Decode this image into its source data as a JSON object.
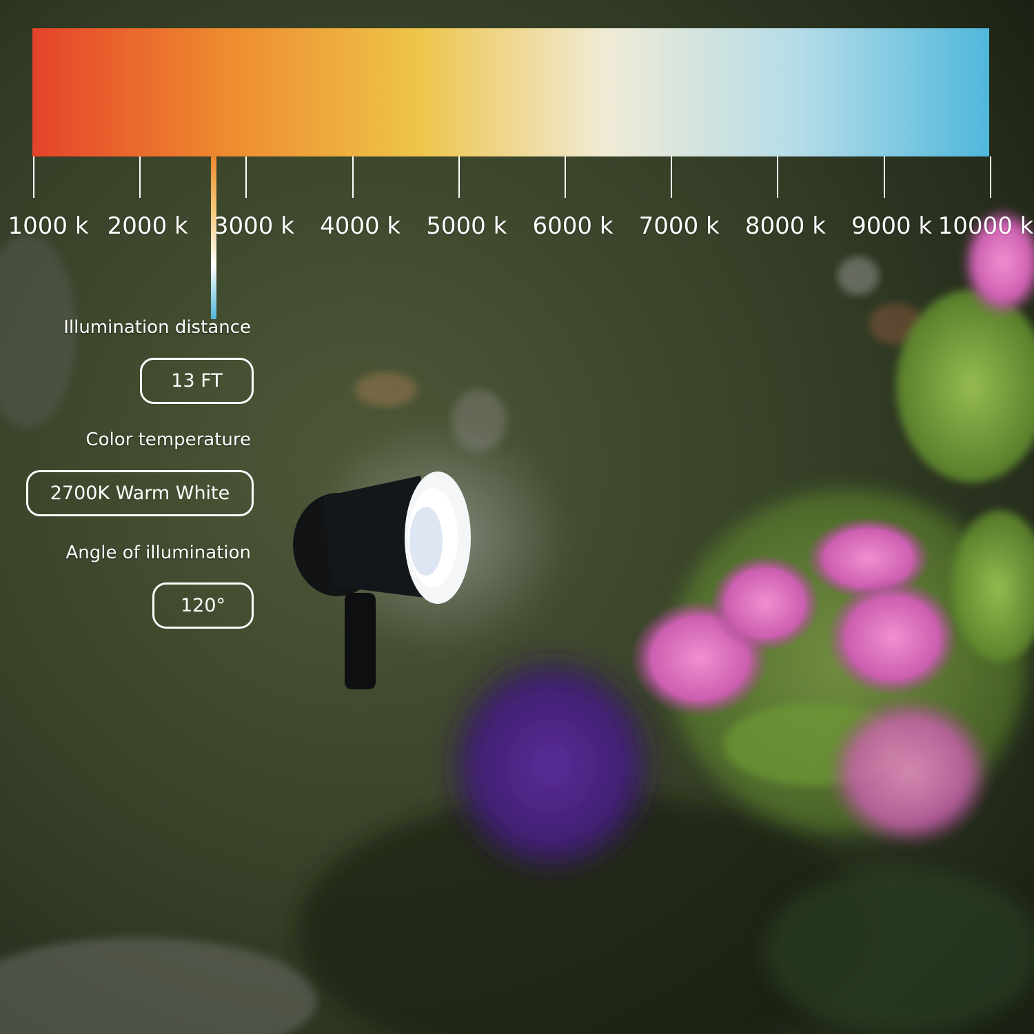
{
  "scale": {
    "ticks": [
      "1000 k",
      "2000 k",
      "3000 k",
      "4000 k",
      "5000 k",
      "6000 k",
      "7000 k",
      "8000 k",
      "9000 k",
      "10000 k"
    ],
    "selected_kelvin": 2700,
    "gradient_colors": [
      "#e5432b",
      "#ee8a2f",
      "#eec448",
      "#f0ebd6",
      "#b5dce8",
      "#4fb7db"
    ]
  },
  "specs": {
    "distance": {
      "label": "Illumination distance",
      "value": "13 FT"
    },
    "color_temp": {
      "label": "Color temperature",
      "value": "2700K Warm White"
    },
    "angle": {
      "label": "Angle of illumination",
      "value": "120°"
    }
  }
}
